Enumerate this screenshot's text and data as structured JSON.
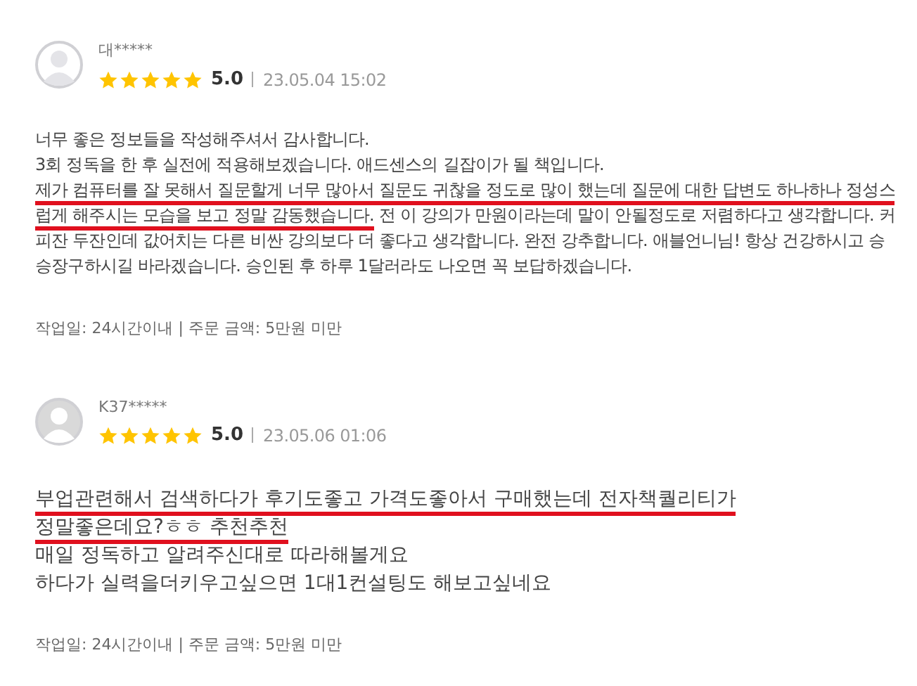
{
  "reviews": [
    {
      "kind": "compact",
      "name": "대*****",
      "stars": 5,
      "rating": "5.0",
      "date": "23.05.04 15:02",
      "lines": [
        {
          "text": "너무 좋은 정보들을 작성해주셔서 감사합니다.",
          "underlined": false
        },
        {
          "text": "3회 정독을 한 후 실전에 적용해보겠습니다. 애드센스의 길잡이가 될 책입니다.",
          "underlined": false
        },
        {
          "text": "제가 컴퓨터를 잘 못해서 질문할게 너무 많아서 질문도 귀찮을 정도로 많이 했는데 질문에 대한 답변도 하나하나 정성스",
          "underlined": true
        },
        {
          "text": "럽게 해주시는 모습을 보고 정말 감동했습니다.",
          "underlined": true,
          "rest": " 전 이 강의가 만원이라는데 말이 안될정도로 저렴하다고 생각합니다. 커"
        },
        {
          "text": "피잔 두잔인데 값어치는 다른 비싼 강의보다 더 좋다고 생각합니다. 완전 강추합니다. 애블언니님! 항상 건강하시고 승",
          "underlined": false
        },
        {
          "text": "승장구하시길 바라겠습니다. 승인된 후 하루 1달러라도 나오면 꼭 보답하겠습니다.",
          "underlined": false
        }
      ],
      "meta": "작업일: 24시간이내 | 주문 금액: 5만원 미만"
    },
    {
      "kind": "large",
      "name": "K37*****",
      "stars": 5,
      "rating": "5.0",
      "date": "23.05.06 01:06",
      "lines": [
        {
          "text": "부업관련해서 검색하다가 후기도좋고 가격도좋아서 구매했는데 전자책퀄리티가",
          "underlined": true
        },
        {
          "text": "정말좋은데요?ㅎㅎ 추천추천",
          "underlined": true
        },
        {
          "text": "매일 정독하고 알려주신대로 따라해볼게요",
          "underlined": false
        },
        {
          "text": "하다가 실력을더키우고싶으면 1대1컨설팅도 해보고싶네요",
          "underlined": false
        }
      ],
      "meta": "작업일: 24시간이내 | 주문 금액: 5만원 미만"
    }
  ]
}
